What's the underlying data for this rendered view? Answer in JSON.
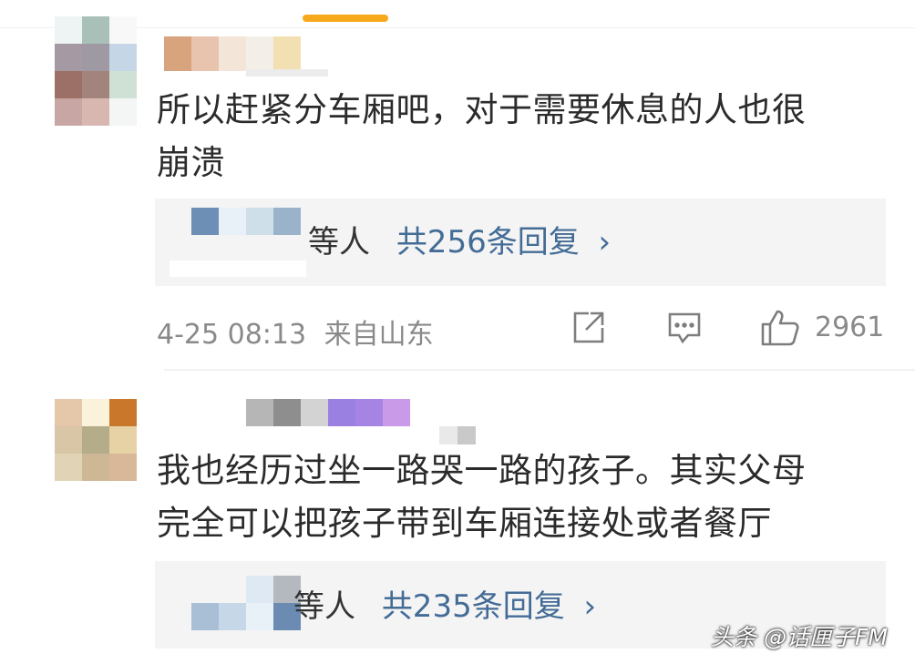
{
  "comments": [
    {
      "text_line1": "所以赶紧分车厢吧，对于需要休息的人也很",
      "text_line2": "崩溃",
      "replies_suffix": "等人",
      "replies_link": "共256条回复",
      "chevron": "›",
      "date": "4-25 08:13",
      "location": "来自山东",
      "like_count": "2961",
      "icons": [
        "share-icon",
        "comment-icon",
        "like-icon"
      ]
    },
    {
      "text_line1": "我也经历过坐一路哭一路的孩子。其实父母",
      "text_line2": "完全可以把孩子带到车厢连接处或者餐厅",
      "replies_suffix": "等人",
      "replies_link": "共235条回复",
      "chevron": "›"
    }
  ],
  "watermark": "头条 @话匣子FM",
  "colors": {
    "tab_indicator": "#f7a91c",
    "link": "#436c96",
    "meta": "#8a8a8a",
    "reply_bg": "#f4f4f4"
  }
}
